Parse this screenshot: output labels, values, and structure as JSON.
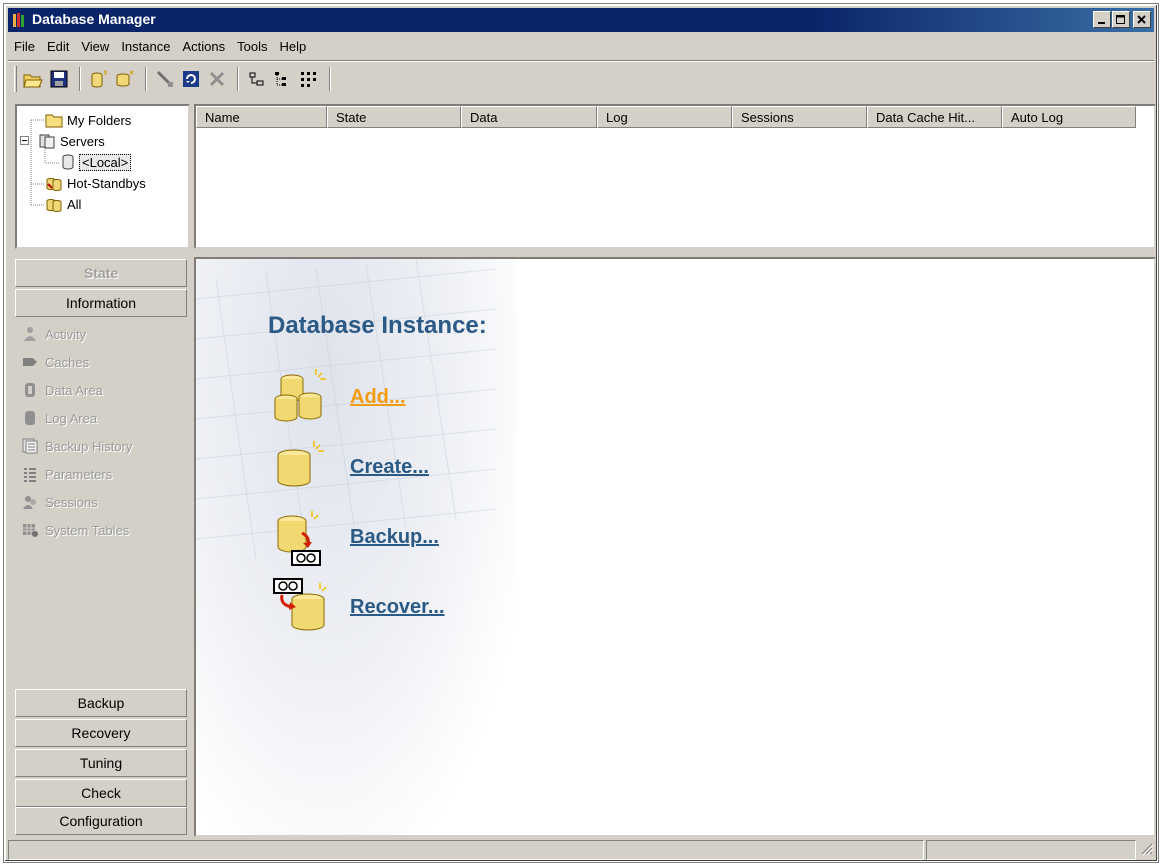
{
  "window": {
    "title": "Database Manager"
  },
  "menu": [
    "File",
    "Edit",
    "View",
    "Instance",
    "Actions",
    "Tools",
    "Help"
  ],
  "tree": {
    "items": [
      {
        "label": "My Folders"
      },
      {
        "label": "Servers"
      },
      {
        "label": "<Local>"
      },
      {
        "label": "Hot-Standbys"
      },
      {
        "label": "All"
      }
    ]
  },
  "list": {
    "columns": [
      "Name",
      "State",
      "Data",
      "Log",
      "Sessions",
      "Data Cache Hit...",
      "Auto Log"
    ]
  },
  "nav": {
    "state": "State",
    "information": "Information",
    "subitems": [
      "Activity",
      "Caches",
      "Data Area",
      "Log Area",
      "Backup History",
      "Parameters",
      "Sessions",
      "System Tables"
    ],
    "bottom": [
      "Backup",
      "Recovery",
      "Tuning",
      "Check",
      "Configuration"
    ]
  },
  "main": {
    "heading": "Database Instance:",
    "actions": [
      "Add...",
      "Create...",
      "Backup...",
      "Recover..."
    ]
  },
  "colors": {
    "titlebar": "#0a246a",
    "link": "#2a5a85",
    "link_hot": "#f39c12"
  }
}
